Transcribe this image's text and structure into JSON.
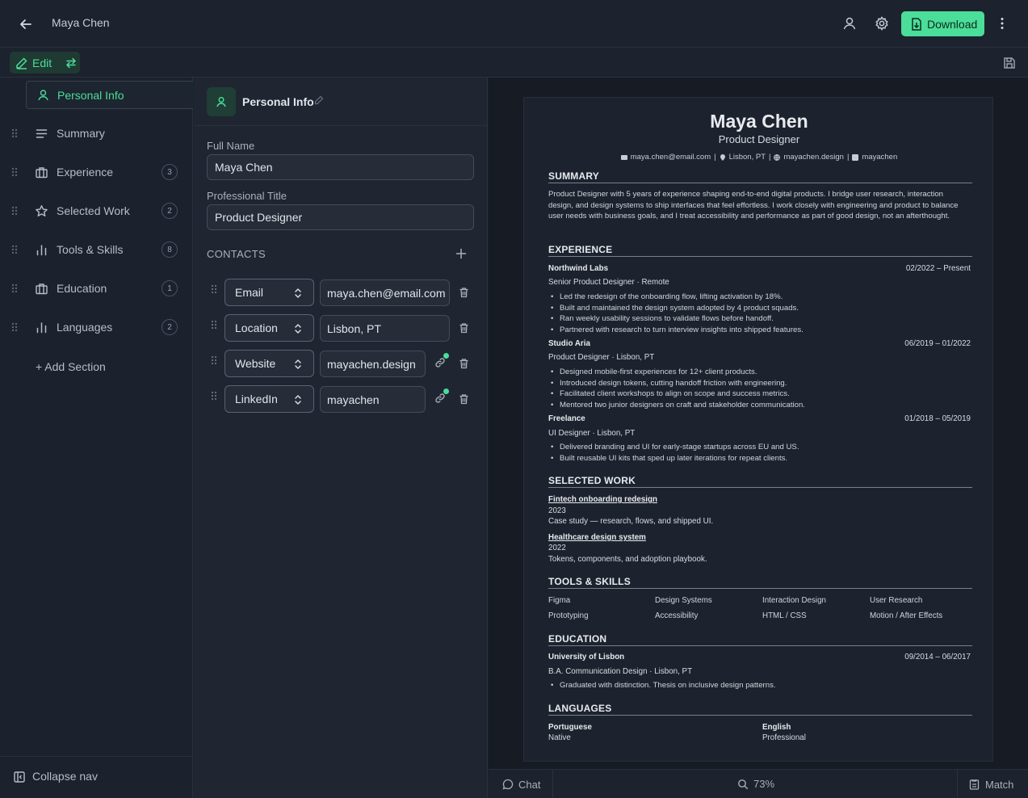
{
  "header": {
    "doc_title": "Maya Chen",
    "download_label": "Download"
  },
  "toolbar": {
    "edit_label": "Edit"
  },
  "nav": {
    "active_label": "Personal Info",
    "items": [
      {
        "label": "Summary",
        "count": ""
      },
      {
        "label": "Experience",
        "count": "3"
      },
      {
        "label": "Selected Work",
        "count": "2"
      },
      {
        "label": "Tools & Skills",
        "count": "8"
      },
      {
        "label": "Education",
        "count": "1"
      },
      {
        "label": "Languages",
        "count": "2"
      }
    ],
    "add_section": "+ Add Section",
    "collapse": "Collapse nav"
  },
  "editor": {
    "title": "Personal Info",
    "full_name_label": "Full Name",
    "full_name_value": "Maya Chen",
    "title_label": "Professional Title",
    "title_value": "Product Designer",
    "contacts_label": "CONTACTS",
    "contacts": [
      {
        "type": "Email",
        "value": "maya.chen@email.com"
      },
      {
        "type": "Location",
        "value": "Lisbon, PT"
      },
      {
        "type": "Website",
        "value": "mayachen.design"
      },
      {
        "type": "LinkedIn",
        "value": "mayachen"
      }
    ]
  },
  "resume": {
    "name": "Maya Chen",
    "role": "Product Designer",
    "contacts": [
      "maya.chen@email.com",
      "Lisbon, PT",
      "mayachen.design",
      "mayachen"
    ],
    "summary_h": "SUMMARY",
    "summary": "Product Designer with 5 years of experience shaping end-to-end digital products. I bridge user research, interaction design, and design systems to ship interfaces that feel effortless. I work closely with engineering and product to balance user needs with business goals, and I treat accessibility and performance as part of good design, not an afterthought.",
    "experience_h": "EXPERIENCE",
    "experience": [
      {
        "company": "Northwind Labs",
        "dates": "02/2022 – Present",
        "subtitle": "Senior Product Designer · Remote",
        "bullets": [
          "Led the redesign of the onboarding flow, lifting activation by 18%.",
          "Built and maintained the design system adopted by 4 product squads.",
          "Ran weekly usability sessions to validate flows before handoff.",
          "Partnered with research to turn interview insights into shipped features."
        ]
      },
      {
        "company": "Studio Aria",
        "dates": "06/2019 – 01/2022",
        "subtitle": "Product Designer · Lisbon, PT",
        "bullets": [
          "Designed mobile-first experiences for 12+ client products.",
          "Introduced design tokens, cutting handoff friction with engineering.",
          "Facilitated client workshops to align on scope and success metrics.",
          "Mentored two junior designers on craft and stakeholder communication."
        ]
      },
      {
        "company": "Freelance",
        "dates": "01/2018 – 05/2019",
        "subtitle": "UI Designer · Lisbon, PT",
        "bullets": [
          "Delivered branding and UI for early-stage startups across EU and US.",
          "Built reusable UI kits that sped up later iterations for repeat clients."
        ]
      }
    ],
    "work_h": "SELECTED WORK",
    "work": [
      {
        "title": "Fintech onboarding redesign",
        "year": "2023",
        "desc": "Case study — research, flows, and shipped UI."
      },
      {
        "title": "Healthcare design system",
        "year": "2022",
        "desc": "Tokens, components, and adoption playbook."
      }
    ],
    "skills_h": "TOOLS & SKILLS",
    "skills": [
      "Figma",
      "Design Systems",
      "Interaction Design",
      "User Research",
      "Prototyping",
      "Accessibility",
      "HTML / CSS",
      "Motion / After Effects"
    ],
    "education_h": "EDUCATION",
    "education": {
      "school": "University of Lisbon",
      "dates": "09/2014 – 06/2017",
      "degree": "B.A. Communication Design · Lisbon, PT",
      "bullet": "Graduated with distinction. Thesis on inclusive design patterns."
    },
    "languages_h": "LANGUAGES",
    "languages": [
      {
        "name": "Portuguese",
        "level": "Native"
      },
      {
        "name": "English",
        "level": "Professional"
      }
    ]
  },
  "bottom": {
    "chat": "Chat",
    "zoom": "73%",
    "match": "Match"
  },
  "colors": {
    "accent": "#4ade9a",
    "bg": "#1b212d"
  }
}
